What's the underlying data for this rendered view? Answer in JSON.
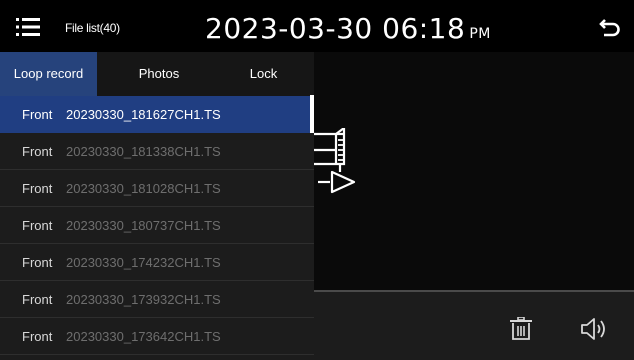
{
  "header": {
    "file_list_label": "File list(40)",
    "date_time": "2023-03-30 06:18",
    "ampm": "PM",
    "icons": {
      "menu": "menu-icon",
      "back": "back-arrow-icon"
    }
  },
  "tabs": [
    {
      "label": "Loop record",
      "active": true
    },
    {
      "label": "Photos",
      "active": false
    },
    {
      "label": "Lock",
      "active": false
    }
  ],
  "files": [
    {
      "camera": "Front",
      "name": "20230330_181627CH1.TS",
      "selected": true
    },
    {
      "camera": "Front",
      "name": "20230330_181338CH1.TS",
      "selected": false
    },
    {
      "camera": "Front",
      "name": "20230330_181028CH1.TS",
      "selected": false
    },
    {
      "camera": "Front",
      "name": "20230330_180737CH1.TS",
      "selected": false
    },
    {
      "camera": "Front",
      "name": "20230330_174232CH1.TS",
      "selected": false
    },
    {
      "camera": "Front",
      "name": "20230330_173932CH1.TS",
      "selected": false
    },
    {
      "camera": "Front",
      "name": "20230330_173642CH1.TS",
      "selected": false
    }
  ],
  "preview": {
    "icon": "video-file-icon"
  },
  "controls": {
    "delete_icon": "trash-icon",
    "volume_icon": "speaker-icon"
  },
  "colors": {
    "accent": "#203e82",
    "tab_active": "#26437c",
    "panel": "#1c1c1c",
    "background": "#0b0b0b"
  }
}
